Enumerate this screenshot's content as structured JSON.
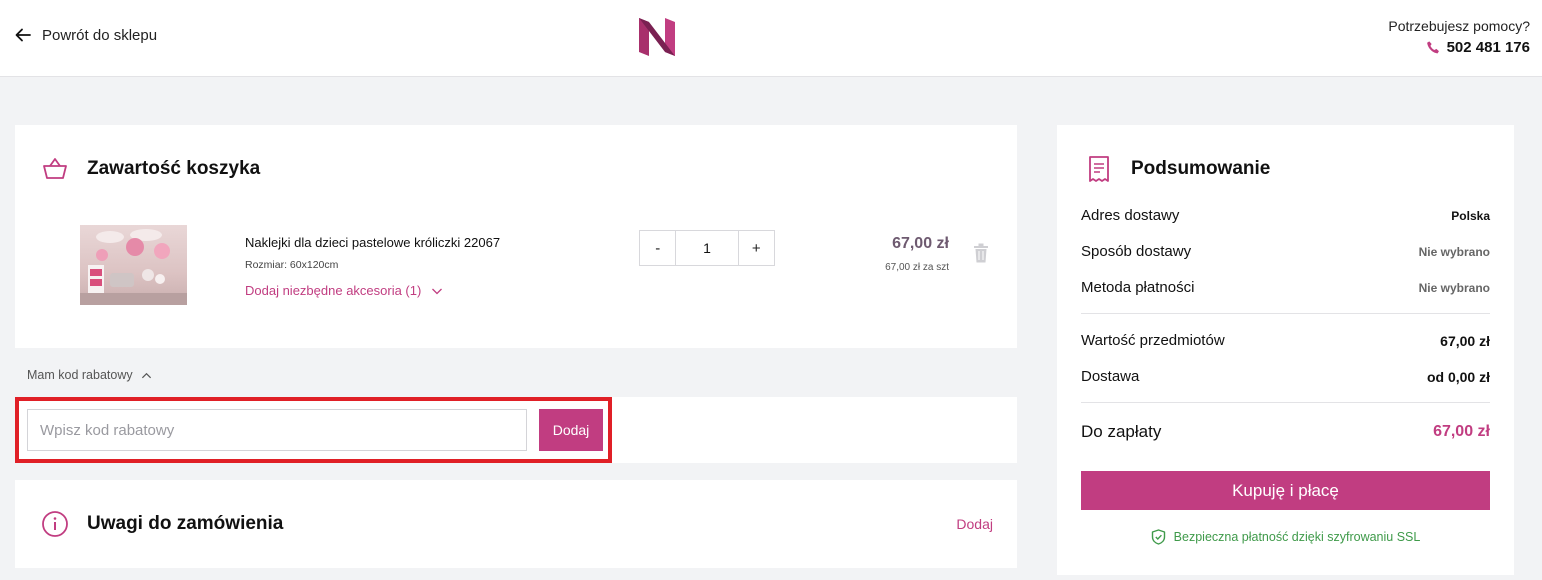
{
  "colors": {
    "accent": "#c13d81",
    "highlight": "#e01f26",
    "success": "#3f9a4a",
    "background": "#f2f3f5"
  },
  "header": {
    "back_label": "Powrót do sklepu",
    "help_label": "Potrzebujesz pomocy?",
    "phone": "502 481 176"
  },
  "cart": {
    "title": "Zawartość koszyka",
    "items": [
      {
        "name": "Naklejki dla dzieci pastelowe króliczki 22067",
        "size": "Rozmiar: 60x120cm",
        "accessories": "Dodaj niezbędne akcesoria (1)",
        "qty_minus": "-",
        "quantity": "1",
        "qty_plus": "+",
        "price": "67,00 zł",
        "unit_price": "67,00 zł za szt"
      }
    ]
  },
  "discount": {
    "toggle_label": "Mam kod rabatowy",
    "placeholder": "Wpisz kod rabatowy",
    "button": "Dodaj"
  },
  "notes": {
    "title": "Uwagi do zamówienia",
    "add_label": "Dodaj"
  },
  "summary": {
    "title": "Podsumowanie",
    "rows": [
      {
        "label": "Adres dostawy",
        "value": "Polska"
      },
      {
        "label": "Sposób dostawy",
        "value": "Nie wybrano"
      },
      {
        "label": "Metoda płatności",
        "value": "Nie wybrano"
      }
    ],
    "items_value_label": "Wartość przedmiotów",
    "items_value": "67,00 zł",
    "shipping_label": "Dostawa",
    "shipping_value": "od 0,00 zł",
    "total_label": "Do zapłaty",
    "total_value": "67,00 zł",
    "buy_button": "Kupuję i płacę",
    "ssl_note": "Bezpieczna płatność dzięki szyfrowaniu SSL"
  }
}
